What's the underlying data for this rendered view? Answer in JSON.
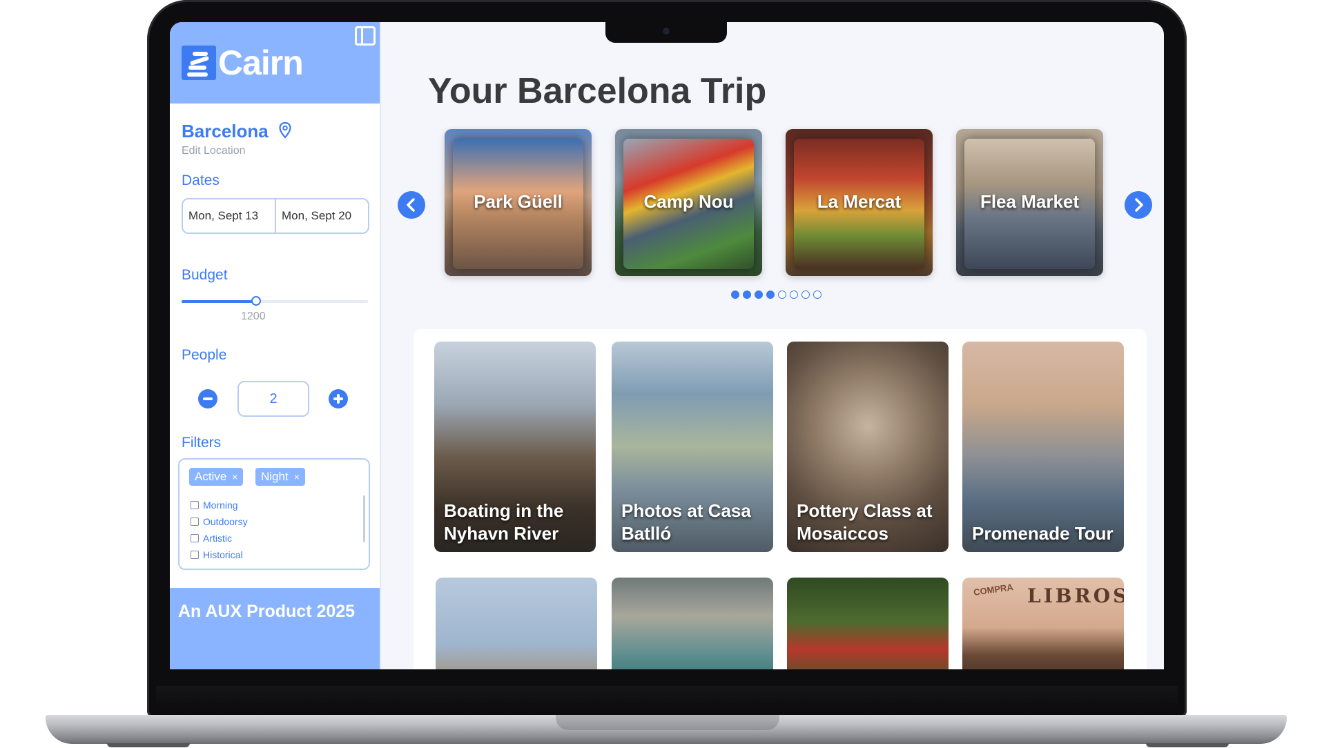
{
  "app": {
    "name": "Cairn"
  },
  "sidebar": {
    "location": {
      "name": "Barcelona",
      "edit_label": "Edit Location"
    },
    "dates": {
      "label": "Dates",
      "start": "Mon, Sept 13",
      "end": "Mon, Sept 20"
    },
    "budget": {
      "label": "Budget",
      "value": "1200",
      "fill_fraction": 0.4
    },
    "people": {
      "label": "People",
      "count": "2"
    },
    "filters": {
      "label": "Filters",
      "active_chips": [
        {
          "label": "Active",
          "remove": "×"
        },
        {
          "label": "Night",
          "remove": "×"
        }
      ],
      "options": [
        {
          "label": "Morning",
          "checked": false
        },
        {
          "label": "Outdoorsy",
          "checked": false
        },
        {
          "label": "Artistic",
          "checked": false
        },
        {
          "label": "Historical",
          "checked": false
        }
      ]
    },
    "footer": {
      "text": "An AUX Product 2025"
    }
  },
  "main": {
    "title": "Your Barcelona Trip",
    "featured": [
      {
        "label": "Park Güell"
      },
      {
        "label": "Camp Nou"
      },
      {
        "label": "La Mercat"
      },
      {
        "label": "Flea Market"
      }
    ],
    "carousel_pages": {
      "total": 8,
      "active": [
        0,
        1,
        2,
        3
      ]
    },
    "activities": [
      {
        "label": "Boating in the Nyhavn River"
      },
      {
        "label": "Photos at Casa Batlló"
      },
      {
        "label": "Pottery Class at Mosaiccos"
      },
      {
        "label": "Promenade Tour"
      }
    ],
    "more_activities": [
      {
        "image": "church-spires"
      },
      {
        "image": "coastal-cove"
      },
      {
        "image": "parrots"
      },
      {
        "image": "bookshop",
        "sign_text": "LIBROS",
        "sign_small": "COMPRA"
      }
    ]
  },
  "colors": {
    "accent": "#3d7bf2",
    "sidebar_header": "#8ab4ff",
    "title_text": "#3a3a3c"
  }
}
